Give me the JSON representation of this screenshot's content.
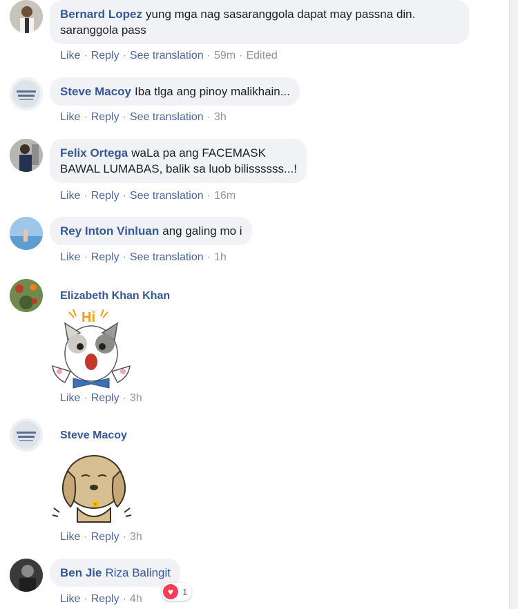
{
  "comments": [
    {
      "author": "Bernard Lopez",
      "text": "yung mga nag sasaranggola dapat may passna din. saranggola pass",
      "actions": {
        "like": "Like",
        "reply": "Reply",
        "translate": "See translation",
        "time": "59m",
        "edited": "Edited"
      }
    },
    {
      "author": "Steve Macoy",
      "text": "Iba tlga ang pinoy malikhain...",
      "actions": {
        "like": "Like",
        "reply": "Reply",
        "translate": "See translation",
        "time": "3h"
      }
    },
    {
      "author": "Felix Ortega",
      "text_line1": "waLa pa ang FACEMASK",
      "text_line2": "BAWAL LUMABAS, balik sa luob bilissssss...!",
      "actions": {
        "like": "Like",
        "reply": "Reply",
        "translate": "See translation",
        "time": "16m"
      }
    },
    {
      "author": "Rey Inton Vinluan",
      "text": "ang galing mo i",
      "actions": {
        "like": "Like",
        "reply": "Reply",
        "translate": "See translation",
        "time": "1h"
      }
    },
    {
      "author": "Elizabeth Khan Khan",
      "sticker": {
        "icon": "cat-hi-sticker",
        "caption": "Hi"
      },
      "actions": {
        "like": "Like",
        "reply": "Reply",
        "time": "3h"
      }
    },
    {
      "author": "Steve Macoy",
      "sticker": {
        "icon": "dog-flower-sticker"
      },
      "actions": {
        "like": "Like",
        "reply": "Reply",
        "time": "3h"
      }
    },
    {
      "author": "Ben Jie",
      "mention": "Riza Balingit",
      "actions": {
        "like": "Like",
        "reply": "Reply",
        "time": "4h"
      },
      "reaction": {
        "icon": "heart-icon",
        "count": "1"
      }
    }
  ],
  "colors": {
    "link": "#4b67a1",
    "author": "#365899",
    "bubble": "#f0f2f5",
    "heart": "#f33e58"
  }
}
